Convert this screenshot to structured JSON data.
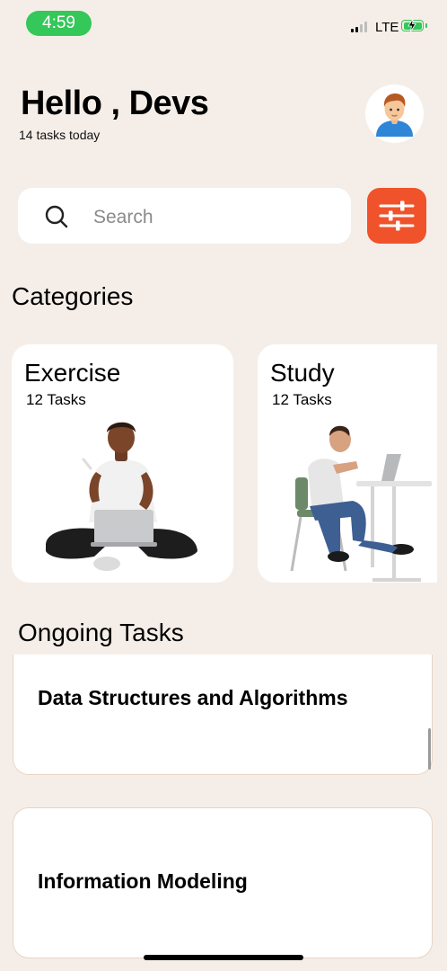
{
  "status_bar": {
    "time": "4:59",
    "network": "LTE"
  },
  "header": {
    "greeting": "Hello , Devs",
    "subtitle": "14 tasks today"
  },
  "search": {
    "placeholder": "Search"
  },
  "categories": {
    "title": "Categories",
    "items": [
      {
        "name": "Exercise",
        "count": "12 Tasks"
      },
      {
        "name": "Study",
        "count": "12 Tasks"
      }
    ]
  },
  "ongoing": {
    "title": "Ongoing Tasks",
    "tasks": [
      {
        "title": "Data Structures and Algorithms"
      },
      {
        "title": "Information Modeling"
      }
    ]
  },
  "colors": {
    "accent": "#f0532b",
    "background": "#f5eee8",
    "status_green": "#34c759"
  },
  "icons": [
    "search-icon",
    "filter-icon",
    "user-avatar-icon",
    "battery-icon",
    "signal-icon"
  ]
}
